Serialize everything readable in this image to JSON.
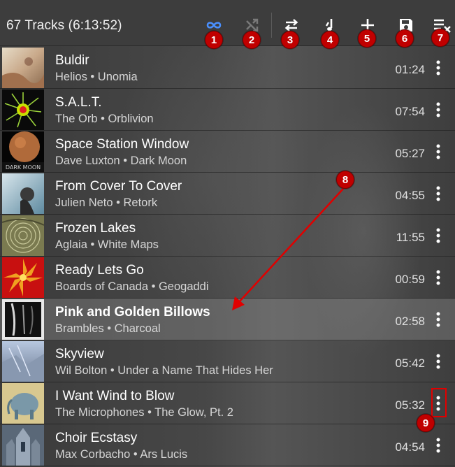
{
  "header": {
    "track_count": "67 Tracks (6:13:52)"
  },
  "toolbar": {
    "buttons": [
      {
        "name": "repeat-infinite",
        "icon": "infinity-icon",
        "color": "#4a90ff"
      },
      {
        "name": "shuffle",
        "icon": "shuffle-icon",
        "color": "#777777"
      },
      {
        "name": "repeat",
        "icon": "swap-arrows-icon",
        "color": "#ffffff"
      },
      {
        "name": "now-playing",
        "icon": "music-note-icon",
        "color": "#ffffff"
      },
      {
        "name": "add",
        "icon": "plus-icon",
        "color": "#ffffff"
      },
      {
        "name": "save",
        "icon": "floppy-icon",
        "color": "#ffffff"
      },
      {
        "name": "clear",
        "icon": "clear-queue-icon",
        "color": "#ffffff"
      }
    ]
  },
  "callouts": [
    "1",
    "2",
    "3",
    "4",
    "5",
    "6",
    "7",
    "8",
    "9"
  ],
  "tracks": [
    {
      "title": "Buldir",
      "subtitle": "Helios • Unomia",
      "duration": "01:24"
    },
    {
      "title": "S.A.L.T.",
      "subtitle": "The Orb • Orblivion",
      "duration": "07:54"
    },
    {
      "title": "Space Station Window",
      "subtitle": "Dave Luxton • Dark Moon",
      "duration": "05:27",
      "cover_text": "DARK MOON"
    },
    {
      "title": "From Cover To Cover",
      "subtitle": "Julien Neto • Retork",
      "duration": "04:55"
    },
    {
      "title": "Frozen Lakes",
      "subtitle": "Aglaia • White Maps",
      "duration": "11:55"
    },
    {
      "title": "Ready Lets Go",
      "subtitle": "Boards of Canada • Geogaddi",
      "duration": "00:59"
    },
    {
      "title": "Pink and Golden Billows",
      "subtitle": "Brambles • Charcoal",
      "duration": "02:58",
      "current": true
    },
    {
      "title": "Skyview",
      "subtitle": "Wil Bolton • Under a Name That Hides Her",
      "duration": "05:42"
    },
    {
      "title": "I Want Wind to Blow",
      "subtitle": "The Microphones • The Glow, Pt. 2",
      "duration": "05:32"
    },
    {
      "title": "Choir Ecstasy",
      "subtitle": "Max Corbacho • Ars Lucis",
      "duration": "04:54"
    }
  ],
  "colors": {
    "accent": "#4a90ff",
    "callout": "#c00000",
    "annotation": "#e00000"
  }
}
